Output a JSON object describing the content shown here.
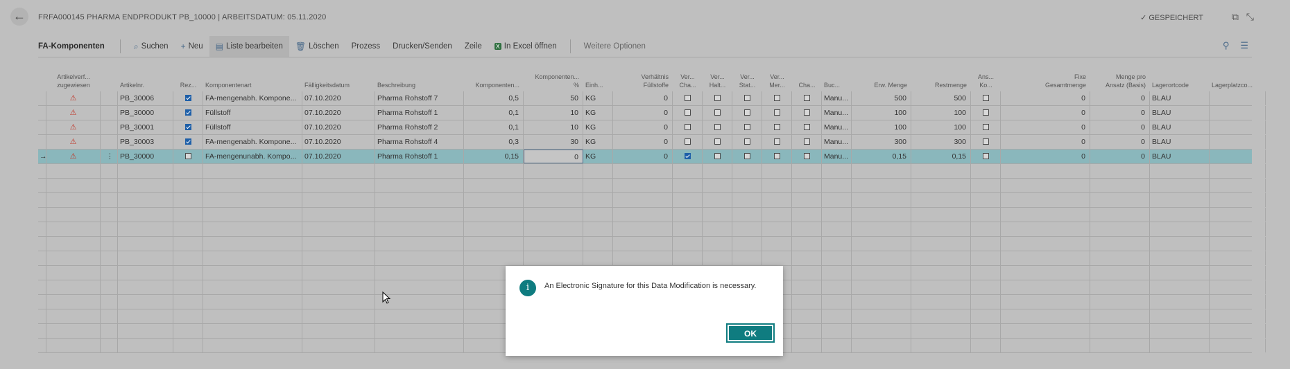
{
  "header": {
    "back_icon": "arrow-left-icon",
    "title": "FRFA000145 PHARMA ENDPRODUKT PB_10000 | ARBEITSDATUM: 05.11.2020",
    "saved_label": "GESPEICHERT"
  },
  "actionbar": {
    "tab_title": "FA-Komponenten",
    "search": "Suchen",
    "new": "Neu",
    "edit_list": "Liste bearbeiten",
    "delete": "Löschen",
    "process": "Prozess",
    "print_send": "Drucken/Senden",
    "line": "Zeile",
    "open_excel": "In Excel öffnen",
    "more_options": "Weitere Optionen"
  },
  "columns": {
    "artikelverf": [
      "Artikelverf...",
      "zugewiesen"
    ],
    "artikelnr": "Artikelnr.",
    "rez": "Rez...",
    "komponentenart": "Komponentenart",
    "faelligkeit": "Fälligkeitsdatum",
    "beschreibung": "Beschreibung",
    "komponenten": "Komponenten...",
    "komp_pct": [
      "Komponenten...",
      "%"
    ],
    "einh": "Einh...",
    "verhaeltnis": [
      "Verhältnis",
      "Füllstoffe"
    ],
    "ver_cha": [
      "Ver...",
      "Cha..."
    ],
    "ver_halt": [
      "Ver...",
      "Halt..."
    ],
    "ver_stat": [
      "Ver...",
      "Stat..."
    ],
    "ver_mer": [
      "Ver...",
      "Mer..."
    ],
    "cha": "Cha...",
    "buc": "Buc...",
    "erw_menge": "Erw. Menge",
    "restmenge": "Restmenge",
    "ans_ko": [
      "Ans...",
      "Ko..."
    ],
    "fixe": [
      "Fixe",
      "Gesamtmenge"
    ],
    "menge_pro": [
      "Menge pro",
      "Ansatz (Basis)"
    ],
    "lagerort": "Lagerortcode",
    "lagerplatz": "Lagerplatzco..."
  },
  "rows": [
    {
      "artikelnr": "PB_30006",
      "rez": true,
      "art": "FA-mengenabh. Kompone...",
      "datum": "07.10.2020",
      "beschr": "Pharma Rohstoff 7",
      "komp": "0,5",
      "pct": "50",
      "einh": "KG",
      "verh": "0",
      "vcha": false,
      "vhalt": false,
      "vstat": false,
      "vmer": false,
      "cha": false,
      "buc": "Manu...",
      "erw": "500",
      "rest": "500",
      "ans": false,
      "fixe": "0",
      "mpro": "0",
      "lager": "BLAU"
    },
    {
      "artikelnr": "PB_30000",
      "rez": true,
      "art": "Füllstoff",
      "datum": "07.10.2020",
      "beschr": "Pharma Rohstoff 1",
      "komp": "0,1",
      "pct": "10",
      "einh": "KG",
      "verh": "0",
      "vcha": false,
      "vhalt": false,
      "vstat": false,
      "vmer": false,
      "cha": false,
      "buc": "Manu...",
      "erw": "100",
      "rest": "100",
      "ans": false,
      "fixe": "0",
      "mpro": "0",
      "lager": "BLAU"
    },
    {
      "artikelnr": "PB_30001",
      "rez": true,
      "art": "Füllstoff",
      "datum": "07.10.2020",
      "beschr": "Pharma Rohstoff 2",
      "komp": "0,1",
      "pct": "10",
      "einh": "KG",
      "verh": "0",
      "vcha": false,
      "vhalt": false,
      "vstat": false,
      "vmer": false,
      "cha": false,
      "buc": "Manu...",
      "erw": "100",
      "rest": "100",
      "ans": false,
      "fixe": "0",
      "mpro": "0",
      "lager": "BLAU"
    },
    {
      "artikelnr": "PB_30003",
      "rez": true,
      "art": "FA-mengenabh. Kompone...",
      "datum": "07.10.2020",
      "beschr": "Pharma Rohstoff 4",
      "komp": "0,3",
      "pct": "30",
      "einh": "KG",
      "verh": "0",
      "vcha": false,
      "vhalt": false,
      "vstat": false,
      "vmer": false,
      "cha": false,
      "buc": "Manu...",
      "erw": "300",
      "rest": "300",
      "ans": false,
      "fixe": "0",
      "mpro": "0",
      "lager": "BLAU"
    },
    {
      "artikelnr": "PB_30000",
      "rez": false,
      "art": "FA-mengenunabh. Kompo...",
      "datum": "07.10.2020",
      "beschr": "Pharma Rohstoff 1",
      "komp": "0,15",
      "pct": "0",
      "einh": "KG",
      "verh": "0",
      "vcha": true,
      "vhalt": false,
      "vstat": false,
      "vmer": false,
      "cha": false,
      "buc": "Manu...",
      "erw": "0,15",
      "rest": "0,15",
      "ans": false,
      "fixe": "0",
      "mpro": "0",
      "lager": "BLAU",
      "selected": true
    }
  ],
  "dialog": {
    "icon": "info-icon",
    "icon_glyph": "i",
    "message": "An Electronic Signature for this Data Modification is necessary.",
    "ok_label": "OK"
  }
}
